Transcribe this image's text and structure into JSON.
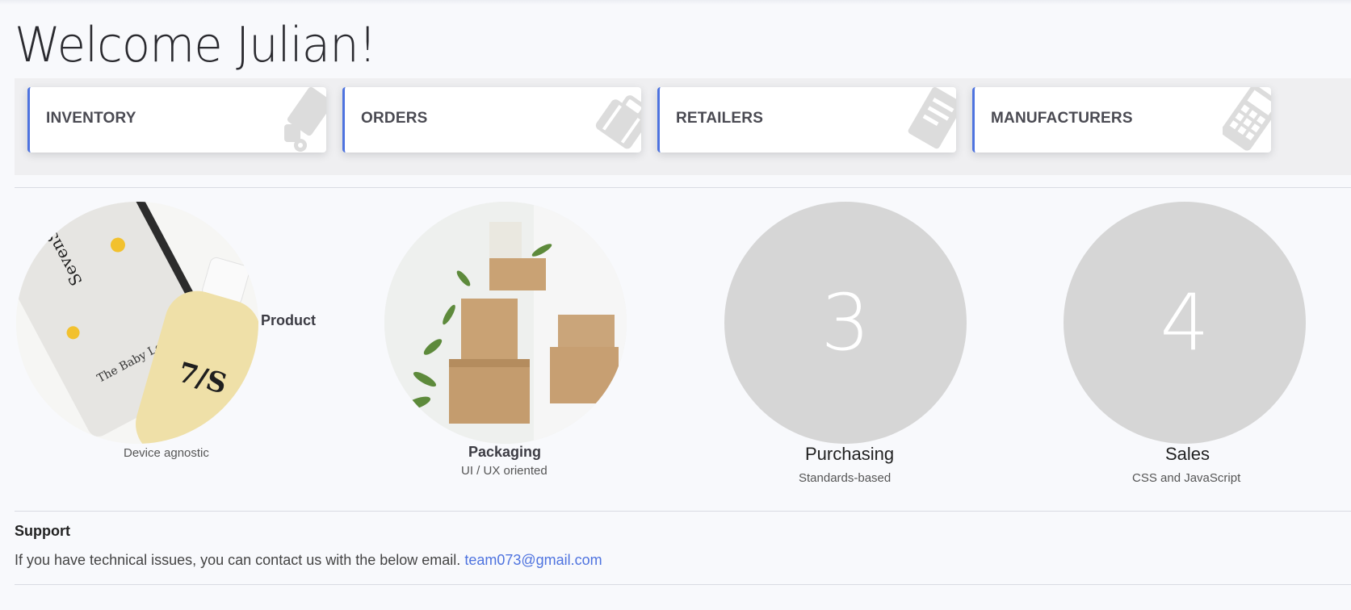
{
  "header": {
    "title": "Welcome Julian!"
  },
  "cards": [
    {
      "label": "INVENTORY",
      "icon": "truck-icon"
    },
    {
      "label": "ORDERS",
      "icon": "luggage-icon"
    },
    {
      "label": "RETAILERS",
      "icon": "receipt-icon"
    },
    {
      "label": "MANUFACTURERS",
      "icon": "calculator-icon"
    }
  ],
  "features": [
    {
      "title": "Product",
      "subtitle": "Device agnostic",
      "image": "product-bottles-image"
    },
    {
      "title": "Packaging",
      "subtitle": "UI / UX oriented",
      "image": "packaging-boxes-image"
    },
    {
      "title": "Purchasing",
      "subtitle": "Standards-based",
      "number": "3"
    },
    {
      "title": "Sales",
      "subtitle": "CSS and JavaScript",
      "number": "4"
    }
  ],
  "support": {
    "title": "Support",
    "text": "If you have technical issues, you can contact us with the below email.",
    "email": "team073@gmail.com"
  },
  "colors": {
    "accent": "#4e73df",
    "placeholder_circle": "#d6d6d6",
    "card_icon": "#dddddd"
  }
}
